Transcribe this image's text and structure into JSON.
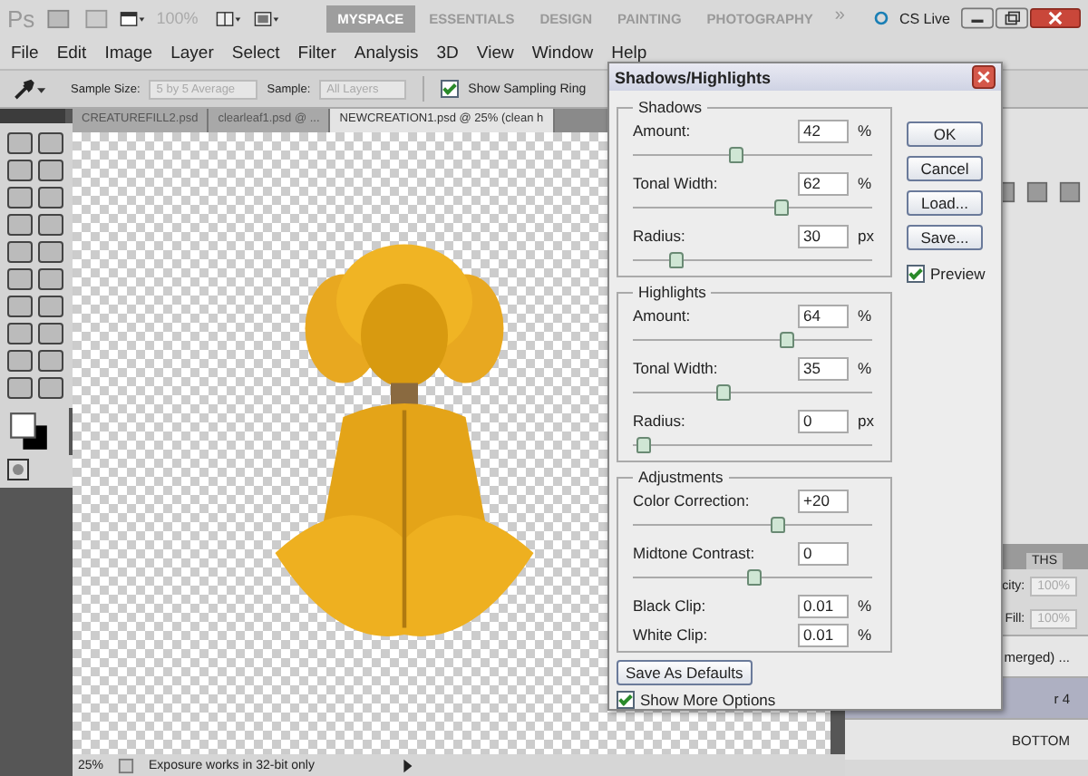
{
  "top_bar": {
    "logo": "Ps",
    "zoom": "100%",
    "workspaces": [
      {
        "label": "MYSPACE",
        "selected": true
      },
      {
        "label": "ESSENTIALS",
        "selected": false
      },
      {
        "label": "DESIGN",
        "selected": false
      },
      {
        "label": "PAINTING",
        "selected": false
      },
      {
        "label": "PHOTOGRAPHY",
        "selected": false
      }
    ],
    "more": "»",
    "cs_live": "CS Live"
  },
  "menu": [
    "File",
    "Edit",
    "Image",
    "Layer",
    "Select",
    "Filter",
    "Analysis",
    "3D",
    "View",
    "Window",
    "Help"
  ],
  "options_bar": {
    "sample_size_label": "Sample Size:",
    "sample_size": "5 by 5 Average",
    "sample_label": "Sample:",
    "sample": "All Layers",
    "sampling_ring": {
      "label": "Show Sampling Ring",
      "checked": true
    }
  },
  "doc_tabs": [
    {
      "label": "CREATUREFILL2.psd",
      "selected": false
    },
    {
      "label": "clearleaf1.psd @ ...",
      "selected": false
    },
    {
      "label": "NEWCREATION1.psd @ 25% (clean h",
      "selected": true
    }
  ],
  "status_bar": {
    "zoom": "25%",
    "message": "Exposure works in 32-bit only"
  },
  "layers_panel": {
    "tab": "THS",
    "opacity_label": "city:",
    "opacity": "100%",
    "fill_label": "Fill:",
    "fill": "100%",
    "layers": [
      {
        "name": "merged) ...",
        "selected": false
      },
      {
        "name": "r 4",
        "selected": true
      },
      {
        "name": "BOTTOM",
        "selected": false
      }
    ]
  },
  "dialog": {
    "title": "Shadows/Highlights",
    "groups": [
      {
        "title": "Shadows",
        "rows": [
          {
            "kind": "slider",
            "label": "Amount:",
            "value": "42",
            "unit": "%",
            "level": 0.42
          },
          {
            "kind": "slider",
            "label": "Tonal Width:",
            "value": "62",
            "unit": "%",
            "level": 0.62
          },
          {
            "kind": "slider",
            "label": "Radius:",
            "value": "30",
            "unit": "px",
            "level": 0.15
          }
        ]
      },
      {
        "title": "Highlights",
        "rows": [
          {
            "kind": "slider",
            "label": "Amount:",
            "value": "64",
            "unit": "%",
            "level": 0.65
          },
          {
            "kind": "slider",
            "label": "Tonal Width:",
            "value": "35",
            "unit": "%",
            "level": 0.36
          },
          {
            "kind": "slider",
            "label": "Radius:",
            "value": "0",
            "unit": "px",
            "level": 0
          }
        ]
      },
      {
        "title": "Adjustments",
        "rows": [
          {
            "kind": "slider",
            "label": "Color Correction:",
            "value": "+20",
            "level": 0.61
          },
          {
            "kind": "slider",
            "label": "Midtone Contrast:",
            "value": "0",
            "level": 0.5
          },
          {
            "kind": "plain",
            "label": "Black Clip:",
            "value": "0.01",
            "unit": "%"
          },
          {
            "kind": "plain",
            "label": "White Clip:",
            "value": "0.01",
            "unit": "%"
          }
        ]
      }
    ],
    "buttons": [
      "OK",
      "Cancel",
      "Load...",
      "Save..."
    ],
    "preview": {
      "label": "Preview",
      "checked": true
    },
    "save_defaults": "Save As Defaults",
    "show_more": {
      "label": "Show More Options",
      "checked": true
    }
  }
}
